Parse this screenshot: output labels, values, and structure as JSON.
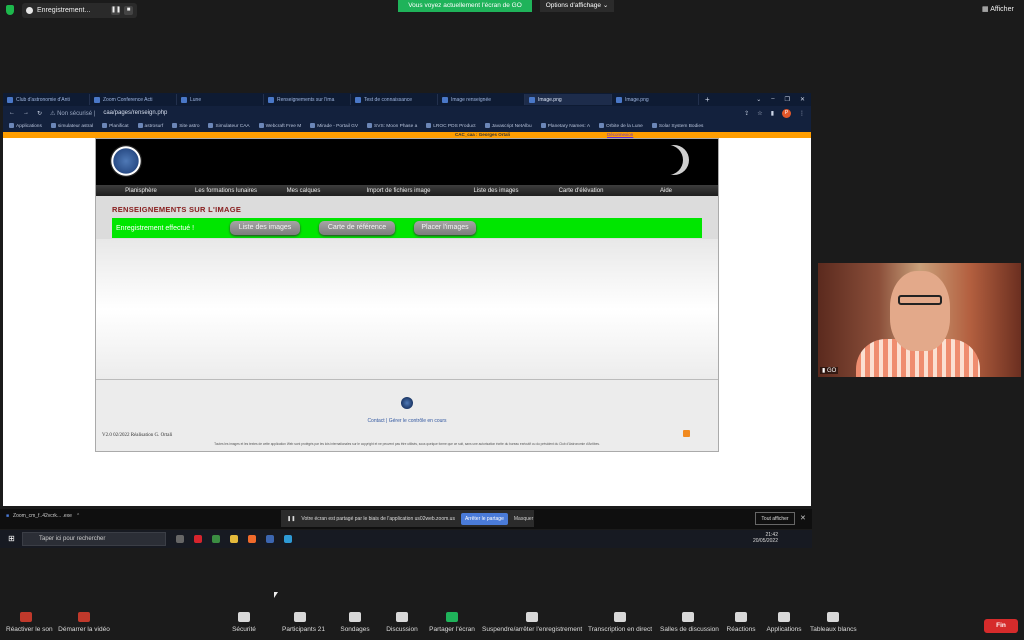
{
  "zoom_top": {
    "recording_label": "Enregistrement...",
    "share_banner": "Vous voyez actuellement l'écran de GO",
    "view_options": "Options d'affichage",
    "show_label": "Afficher"
  },
  "browser": {
    "tabs": [
      "Club d'astronomie d'Anti",
      "Zoom Conference Acti",
      "Lune",
      "Renseignements sur l'ima",
      "Test de connaissance",
      "Image renseignée",
      "Image.png",
      "Image.png"
    ],
    "active_tab": 6,
    "address_warning": "Non sécurisé",
    "url": "caa/pages/renseign.php",
    "bookmarks": [
      "Applications",
      "simulateur astral",
      "Planificat",
      "astrosurf",
      "Site astro",
      "Simulateur CAA",
      "Webcraft Free M",
      "Mirade - Portail GV",
      "SVS: Moon Phase a",
      "LROC PDS Product",
      "Javascript NetAlbu",
      "Planetary Names: A",
      "Orbite de la Lune",
      "Solar System Bodies"
    ],
    "avatar_letter": "P",
    "orange_bar_left": "CAC_caa : Georges Ortali",
    "orange_bar_right": "Déconnexion"
  },
  "site": {
    "nav": [
      "Planisphère",
      "Les formations lunaires",
      "Mes calques",
      "Import de fichiers image",
      "Liste des images",
      "Carte d'élévation",
      "Aide"
    ],
    "section_title": "RENSEIGNEMENTS SUR L'IMAGE",
    "status_text": "Enregistrement effectué !",
    "buttons": [
      "Liste des images",
      "Carte de référence",
      "Placer l'images"
    ],
    "footer_links": "Contact  |  Gérer le contrôle en cours",
    "version": "V2.0 02/2022 Réalisation G. Ortali",
    "legal": "Toutes les images et les textes de cette application Web sont protégés par les lois internationales sur le copyright et ne peuvent pas être utilisés, sous quelque forme que ce soit, sans une autorisation écrite du bureau exécutif ou du président du Club d'Astronomie d'Antibes."
  },
  "share_bar": {
    "taskitem": "Zoom_cm_f..42vcrk... .exe",
    "message": "Votre écran est partagé par le biais de l'application us02web.zoom.us",
    "stop": "Arrêter le partage",
    "hide": "Masquer",
    "show_all": "Tout afficher"
  },
  "taskbar": {
    "search_placeholder": "Taper ici pour rechercher",
    "time": "21:42",
    "date": "20/05/2022"
  },
  "video": {
    "participant": "GO"
  },
  "controls": {
    "items": [
      "Réactiver le son",
      "Démarrer la vidéo",
      "Sécurité",
      "Participants",
      "Sondages",
      "Discussion",
      "Partager l'écran",
      "Suspendre/arrêter l'enregistrement",
      "Transcription en direct",
      "Salles de discussion",
      "Réactions",
      "Applications",
      "Tableaux blancs"
    ],
    "participants_count": "21",
    "end": "Fin"
  },
  "colors": {
    "share_green": "#1fb35a",
    "status_green": "#00e600",
    "end_red": "#d62b2b",
    "accent_orange": "#ff9e00"
  }
}
